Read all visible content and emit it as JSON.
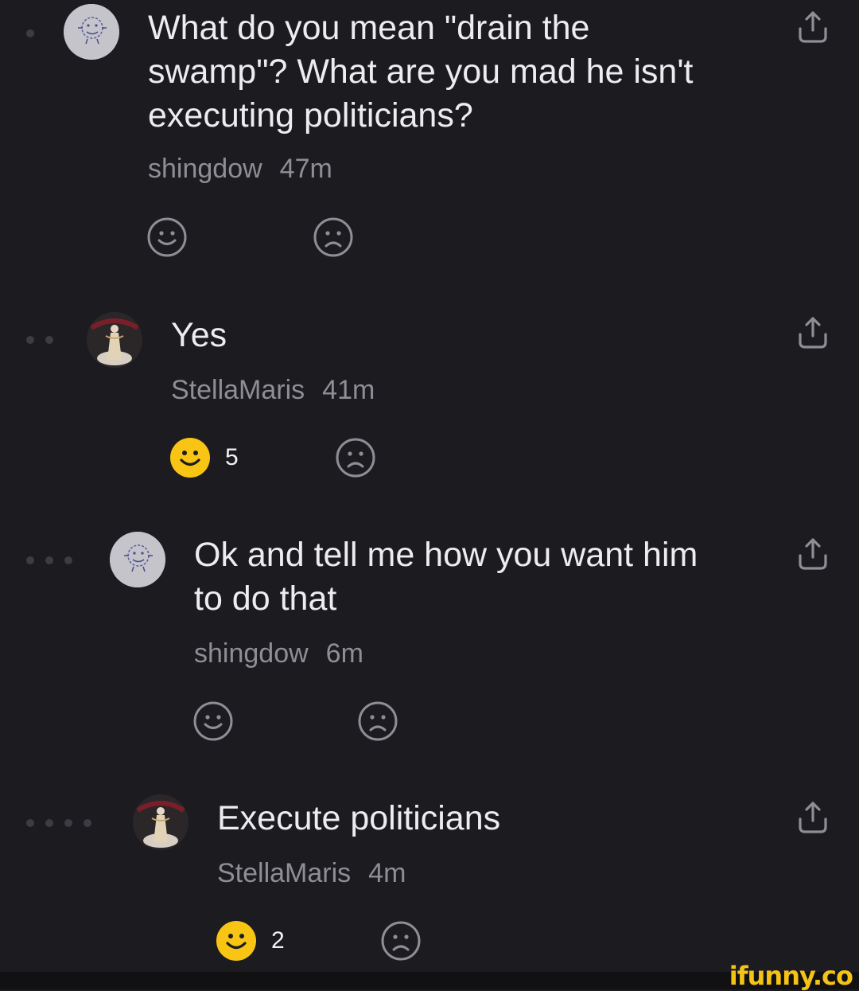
{
  "comments": [
    {
      "text": "What do you mean \"drain the swamp\"? What are you mad he isn't executing politicians?",
      "author": "shingdow",
      "time": "47m",
      "likes": ""
    },
    {
      "text": "Yes",
      "author": "StellaMaris",
      "time": "41m",
      "likes": "5"
    },
    {
      "text": "Ok and tell me how you want him to do that",
      "author": "shingdow",
      "time": "6m",
      "likes": ""
    },
    {
      "text": "Execute politicians",
      "author": "StellaMaris",
      "time": "4m",
      "likes": "2"
    }
  ],
  "icons": {
    "share": "share-icon",
    "smile": "smile-icon",
    "frown": "frown-icon",
    "avatar_shingdow": "doodle-face-avatar",
    "avatar_stellamaris": "statue-avatar"
  },
  "colors": {
    "background": "#1c1b20",
    "text": "#ededf0",
    "meta": "#8e8e95",
    "like_active": "#f8c514",
    "logo": "#f4c316"
  },
  "watermark": "ifunny.co"
}
